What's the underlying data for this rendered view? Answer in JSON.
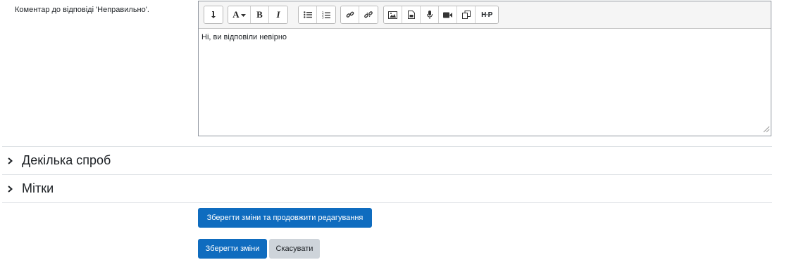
{
  "feedback_label": "Коментар до відповіді 'Неправильно'.",
  "editor_content": "Ні, ви відповіли невірно",
  "toolbar_icons": [
    "toggle-icon",
    "font-style-icon",
    "bold-icon",
    "italic-icon",
    "unordered-list-icon",
    "ordered-list-icon",
    "link-icon",
    "unlink-icon",
    "image-icon",
    "media-icon",
    "microphone-icon",
    "video-icon",
    "copy-icon",
    "h5p-icon"
  ],
  "toolbar": {
    "font_label": "A",
    "bold_label": "B",
    "italic_label": "I",
    "h5p_label": "H·P"
  },
  "sections": [
    {
      "title": "Декілька спроб"
    },
    {
      "title": "Мітки"
    }
  ],
  "buttons": {
    "save_continue": "Зберегти зміни та продовжити редагування",
    "save": "Зберегти зміни",
    "cancel": "Скасувати"
  },
  "colors": {
    "primary": "#0f6cbf",
    "secondary": "#ced4da"
  }
}
